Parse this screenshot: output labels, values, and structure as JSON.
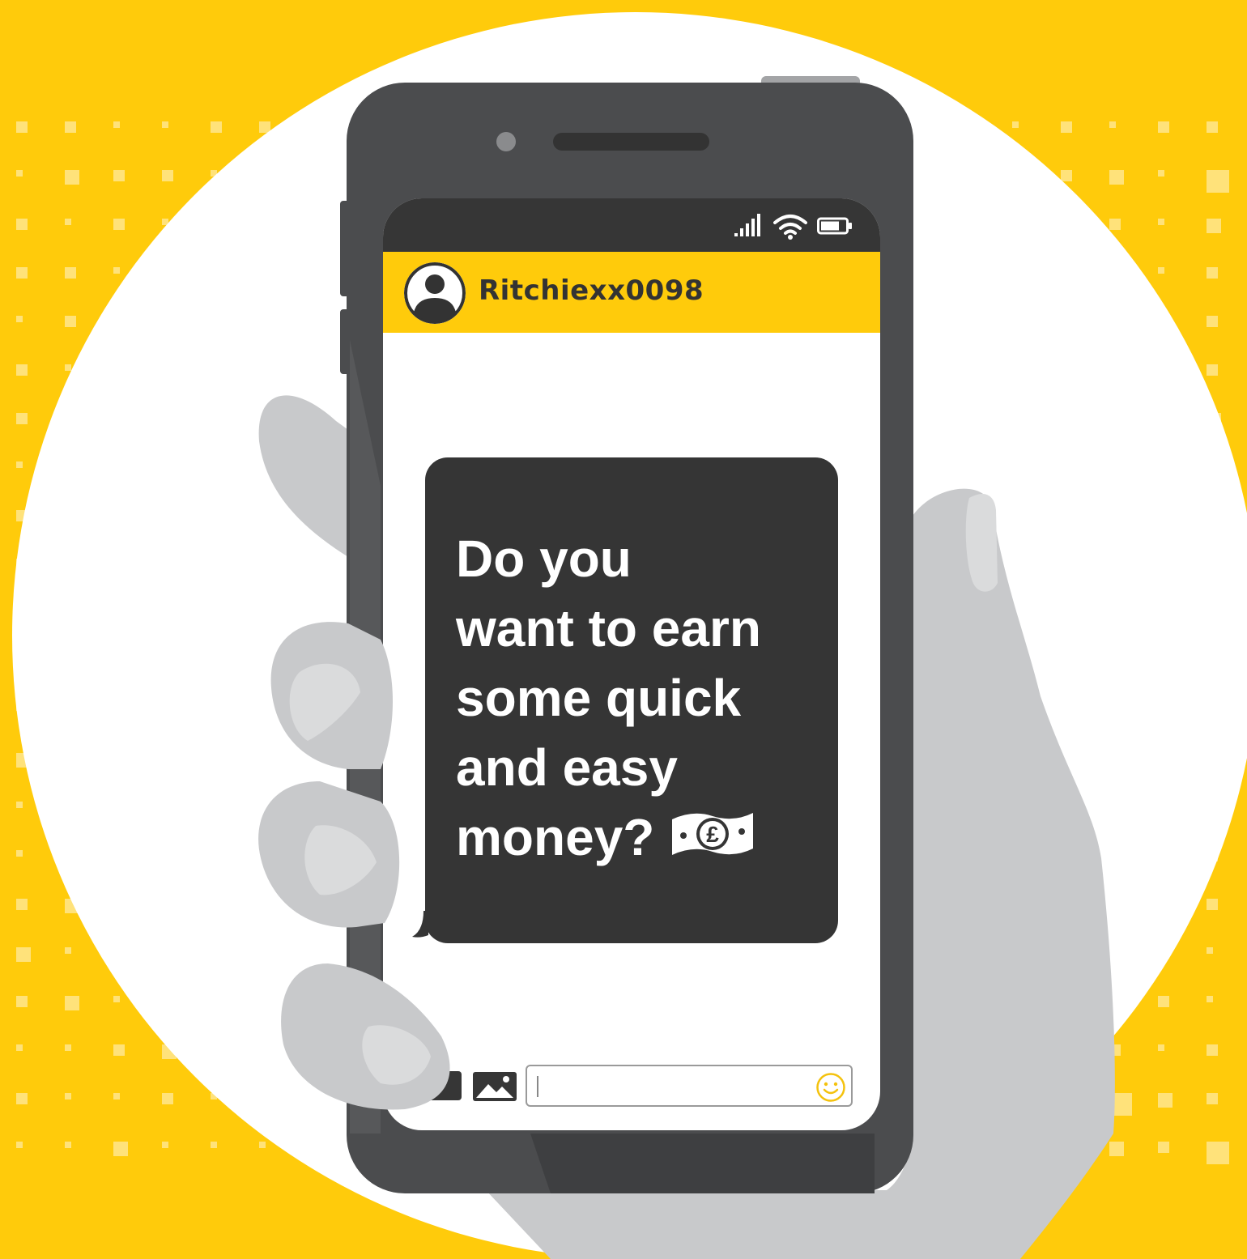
{
  "colors": {
    "background": "#FFCB0B",
    "background_dots": "#FFE27A",
    "circle": "#FFFFFF",
    "phone_body": "#4B4C4E",
    "status_bar": "#363636",
    "chat_header": "#FFCB0B",
    "bubble": "#353535",
    "hand": "#C8C9CB",
    "nail": "#DADBDC"
  },
  "status_bar": {
    "icons": [
      "signal-icon",
      "wifi-icon",
      "battery-icon"
    ]
  },
  "chat": {
    "contact_name": "Ritchiexx0098",
    "avatar_icon": "user-avatar-icon"
  },
  "message": {
    "lines": [
      "Do you",
      "want to earn",
      "some quick",
      "and easy",
      "money?"
    ],
    "trailing_icon": "pound-banknote-icon"
  },
  "composer": {
    "camera_icon": "camera-icon",
    "gallery_icon": "image-gallery-icon",
    "input_value": "",
    "emoji_icon": "smiley-icon"
  }
}
